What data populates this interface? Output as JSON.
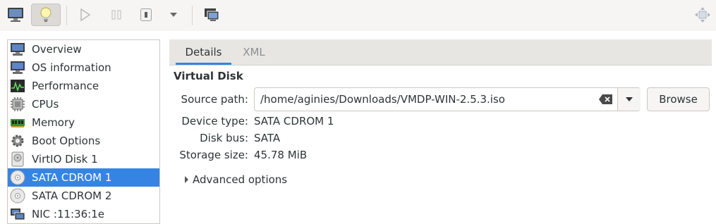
{
  "sidebar": {
    "items": [
      {
        "label": "Overview",
        "icon": "monitor-icon"
      },
      {
        "label": "OS information",
        "icon": "monitor-icon"
      },
      {
        "label": "Performance",
        "icon": "performance-graph-icon"
      },
      {
        "label": "CPUs",
        "icon": "cpu-chip-icon"
      },
      {
        "label": "Memory",
        "icon": "memory-module-icon"
      },
      {
        "label": "Boot Options",
        "icon": "gear-icon"
      },
      {
        "label": "VirtIO Disk 1",
        "icon": "disk-drive-icon"
      },
      {
        "label": "SATA CDROM 1",
        "icon": "cdrom-icon",
        "selected": true
      },
      {
        "label": "SATA CDROM 2",
        "icon": "cdrom-icon"
      },
      {
        "label": "NIC :11:36:1e",
        "icon": "network-card-icon"
      }
    ]
  },
  "tabs": [
    {
      "label": "Details",
      "active": true
    },
    {
      "label": "XML",
      "active": false
    }
  ],
  "section": {
    "title": "Virtual Disk"
  },
  "fields": {
    "source_path_label": "Source path:",
    "source_path_value": "/home/aginies/Downloads/VMDP-WIN-2.5.3.iso",
    "device_type_label": "Device type:",
    "device_type_value": "SATA CDROM 1",
    "disk_bus_label": "Disk bus:",
    "disk_bus_value": "SATA",
    "storage_size_label": "Storage size:",
    "storage_size_value": "45.78 MiB"
  },
  "browse_label": "Browse",
  "advanced_label": "Advanced options",
  "colors": {
    "selection": "#3584e4",
    "tab_underline": "#3584e4"
  }
}
